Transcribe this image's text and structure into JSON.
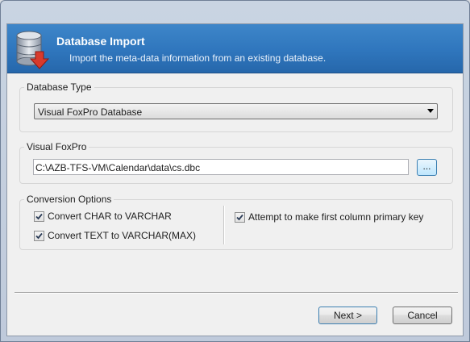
{
  "dialog": {
    "title": "Database Import",
    "subtitle": "Import the meta-data information from an existing database."
  },
  "database_type": {
    "label": "Database Type",
    "selected": "Visual FoxPro Database"
  },
  "visual_foxpro": {
    "label": "Visual FoxPro",
    "path": "C:\\AZB-TFS-VM\\Calendar\\data\\cs.dbc",
    "browse_label": "..."
  },
  "conversion_options": {
    "label": "Conversion Options",
    "options": [
      {
        "label": "Convert CHAR to VARCHAR",
        "checked": true
      },
      {
        "label": "Convert TEXT to VARCHAR(MAX)",
        "checked": true
      },
      {
        "label": "Attempt to make first column primary key",
        "checked": true
      }
    ]
  },
  "buttons": {
    "next": "Next >",
    "cancel": "Cancel"
  },
  "colors": {
    "header_blue": "#2f76bd",
    "icon_arrow_red": "#d83a2c"
  },
  "icons": {
    "header": "database-import-icon"
  }
}
